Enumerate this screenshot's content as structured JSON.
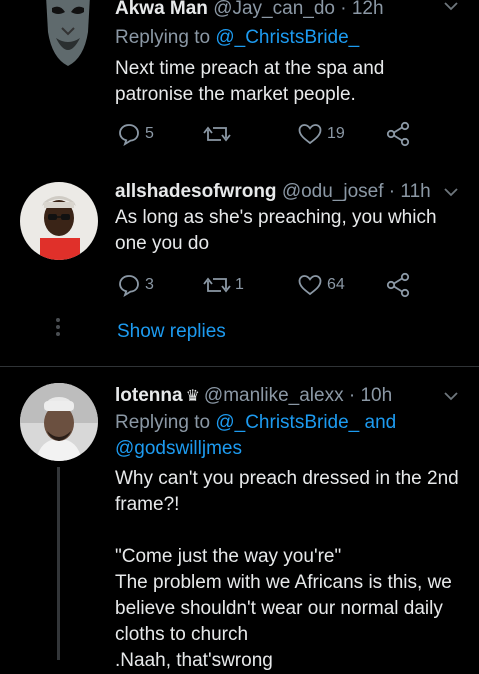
{
  "tweets": [
    {
      "name": "Akwa Man",
      "handle": "@Jay_can_do",
      "separator": "·",
      "time": "12h",
      "replying_prefix": "Replying to ",
      "replying_to": "@_ChristsBride_",
      "text": "Next time preach at the spa and\npatronise the market people.",
      "replies": "5",
      "retweets": "",
      "likes": "19"
    },
    {
      "name": "allshadesofwrong",
      "handle": "@odu_josef",
      "separator": "·",
      "time": "11h",
      "text": "As long as she's preaching, you which\none you do",
      "replies": "3",
      "retweets": "1",
      "likes": "64",
      "show_replies": "Show replies"
    },
    {
      "name": "lotenna",
      "crown": "♛",
      "handle": "@manlike_alexx",
      "separator": "·",
      "time": "10h",
      "replying_prefix": "Replying to ",
      "replying_to_1": "@_ChristsBride_",
      "replying_and": " and",
      "replying_to_2": "@godswilljmes",
      "text": "Why can't you preach dressed in the 2nd\nframe?!\n\n\"Come just the way you're\"\nThe problem with we Africans is this, we\nbelieve shouldn't wear our normal daily\ncloths to church\n.Naah, that'swrong"
    }
  ],
  "colors": {
    "background": "#000000",
    "text": "#e7e9ea",
    "secondary": "#8b98a5",
    "accent": "#1d9bf0",
    "divider": "#2f3336"
  }
}
